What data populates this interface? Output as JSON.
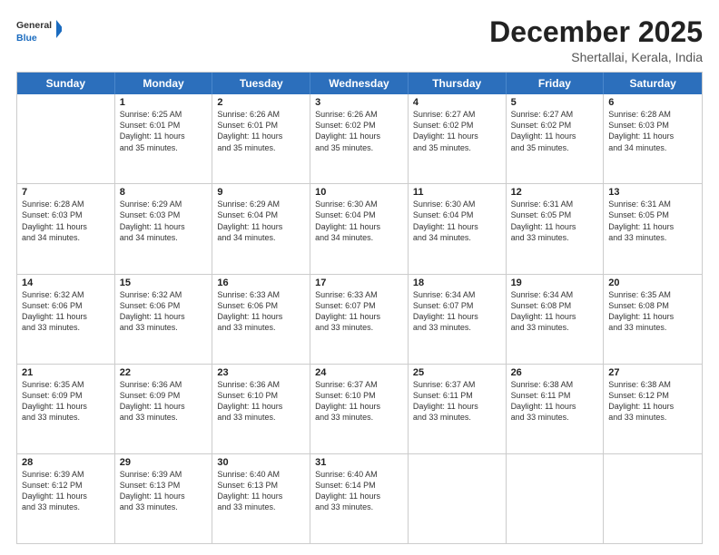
{
  "logo": {
    "general": "General",
    "blue": "Blue"
  },
  "title": "December 2025",
  "location": "Shertallai, Kerala, India",
  "days": [
    "Sunday",
    "Monday",
    "Tuesday",
    "Wednesday",
    "Thursday",
    "Friday",
    "Saturday"
  ],
  "weeks": [
    [
      {
        "day": "",
        "lines": []
      },
      {
        "day": "1",
        "lines": [
          "Sunrise: 6:25 AM",
          "Sunset: 6:01 PM",
          "Daylight: 11 hours",
          "and 35 minutes."
        ]
      },
      {
        "day": "2",
        "lines": [
          "Sunrise: 6:26 AM",
          "Sunset: 6:01 PM",
          "Daylight: 11 hours",
          "and 35 minutes."
        ]
      },
      {
        "day": "3",
        "lines": [
          "Sunrise: 6:26 AM",
          "Sunset: 6:02 PM",
          "Daylight: 11 hours",
          "and 35 minutes."
        ]
      },
      {
        "day": "4",
        "lines": [
          "Sunrise: 6:27 AM",
          "Sunset: 6:02 PM",
          "Daylight: 11 hours",
          "and 35 minutes."
        ]
      },
      {
        "day": "5",
        "lines": [
          "Sunrise: 6:27 AM",
          "Sunset: 6:02 PM",
          "Daylight: 11 hours",
          "and 35 minutes."
        ]
      },
      {
        "day": "6",
        "lines": [
          "Sunrise: 6:28 AM",
          "Sunset: 6:03 PM",
          "Daylight: 11 hours",
          "and 34 minutes."
        ]
      }
    ],
    [
      {
        "day": "7",
        "lines": [
          "Sunrise: 6:28 AM",
          "Sunset: 6:03 PM",
          "Daylight: 11 hours",
          "and 34 minutes."
        ]
      },
      {
        "day": "8",
        "lines": [
          "Sunrise: 6:29 AM",
          "Sunset: 6:03 PM",
          "Daylight: 11 hours",
          "and 34 minutes."
        ]
      },
      {
        "day": "9",
        "lines": [
          "Sunrise: 6:29 AM",
          "Sunset: 6:04 PM",
          "Daylight: 11 hours",
          "and 34 minutes."
        ]
      },
      {
        "day": "10",
        "lines": [
          "Sunrise: 6:30 AM",
          "Sunset: 6:04 PM",
          "Daylight: 11 hours",
          "and 34 minutes."
        ]
      },
      {
        "day": "11",
        "lines": [
          "Sunrise: 6:30 AM",
          "Sunset: 6:04 PM",
          "Daylight: 11 hours",
          "and 34 minutes."
        ]
      },
      {
        "day": "12",
        "lines": [
          "Sunrise: 6:31 AM",
          "Sunset: 6:05 PM",
          "Daylight: 11 hours",
          "and 33 minutes."
        ]
      },
      {
        "day": "13",
        "lines": [
          "Sunrise: 6:31 AM",
          "Sunset: 6:05 PM",
          "Daylight: 11 hours",
          "and 33 minutes."
        ]
      }
    ],
    [
      {
        "day": "14",
        "lines": [
          "Sunrise: 6:32 AM",
          "Sunset: 6:06 PM",
          "Daylight: 11 hours",
          "and 33 minutes."
        ]
      },
      {
        "day": "15",
        "lines": [
          "Sunrise: 6:32 AM",
          "Sunset: 6:06 PM",
          "Daylight: 11 hours",
          "and 33 minutes."
        ]
      },
      {
        "day": "16",
        "lines": [
          "Sunrise: 6:33 AM",
          "Sunset: 6:06 PM",
          "Daylight: 11 hours",
          "and 33 minutes."
        ]
      },
      {
        "day": "17",
        "lines": [
          "Sunrise: 6:33 AM",
          "Sunset: 6:07 PM",
          "Daylight: 11 hours",
          "and 33 minutes."
        ]
      },
      {
        "day": "18",
        "lines": [
          "Sunrise: 6:34 AM",
          "Sunset: 6:07 PM",
          "Daylight: 11 hours",
          "and 33 minutes."
        ]
      },
      {
        "day": "19",
        "lines": [
          "Sunrise: 6:34 AM",
          "Sunset: 6:08 PM",
          "Daylight: 11 hours",
          "and 33 minutes."
        ]
      },
      {
        "day": "20",
        "lines": [
          "Sunrise: 6:35 AM",
          "Sunset: 6:08 PM",
          "Daylight: 11 hours",
          "and 33 minutes."
        ]
      }
    ],
    [
      {
        "day": "21",
        "lines": [
          "Sunrise: 6:35 AM",
          "Sunset: 6:09 PM",
          "Daylight: 11 hours",
          "and 33 minutes."
        ]
      },
      {
        "day": "22",
        "lines": [
          "Sunrise: 6:36 AM",
          "Sunset: 6:09 PM",
          "Daylight: 11 hours",
          "and 33 minutes."
        ]
      },
      {
        "day": "23",
        "lines": [
          "Sunrise: 6:36 AM",
          "Sunset: 6:10 PM",
          "Daylight: 11 hours",
          "and 33 minutes."
        ]
      },
      {
        "day": "24",
        "lines": [
          "Sunrise: 6:37 AM",
          "Sunset: 6:10 PM",
          "Daylight: 11 hours",
          "and 33 minutes."
        ]
      },
      {
        "day": "25",
        "lines": [
          "Sunrise: 6:37 AM",
          "Sunset: 6:11 PM",
          "Daylight: 11 hours",
          "and 33 minutes."
        ]
      },
      {
        "day": "26",
        "lines": [
          "Sunrise: 6:38 AM",
          "Sunset: 6:11 PM",
          "Daylight: 11 hours",
          "and 33 minutes."
        ]
      },
      {
        "day": "27",
        "lines": [
          "Sunrise: 6:38 AM",
          "Sunset: 6:12 PM",
          "Daylight: 11 hours",
          "and 33 minutes."
        ]
      }
    ],
    [
      {
        "day": "28",
        "lines": [
          "Sunrise: 6:39 AM",
          "Sunset: 6:12 PM",
          "Daylight: 11 hours",
          "and 33 minutes."
        ]
      },
      {
        "day": "29",
        "lines": [
          "Sunrise: 6:39 AM",
          "Sunset: 6:13 PM",
          "Daylight: 11 hours",
          "and 33 minutes."
        ]
      },
      {
        "day": "30",
        "lines": [
          "Sunrise: 6:40 AM",
          "Sunset: 6:13 PM",
          "Daylight: 11 hours",
          "and 33 minutes."
        ]
      },
      {
        "day": "31",
        "lines": [
          "Sunrise: 6:40 AM",
          "Sunset: 6:14 PM",
          "Daylight: 11 hours",
          "and 33 minutes."
        ]
      },
      {
        "day": "",
        "lines": []
      },
      {
        "day": "",
        "lines": []
      },
      {
        "day": "",
        "lines": []
      }
    ]
  ]
}
